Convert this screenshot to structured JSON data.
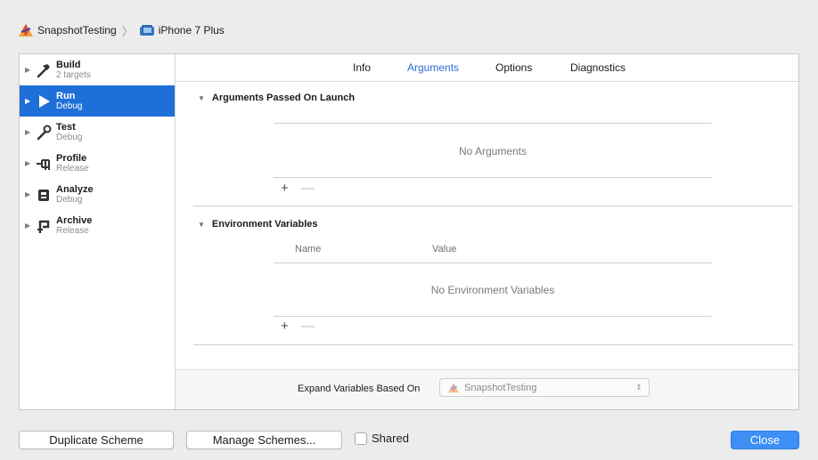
{
  "breadcrumb": {
    "project": "SnapshotTesting",
    "separator": "〉",
    "device": "iPhone 7 Plus"
  },
  "sidebar": {
    "items": [
      {
        "title": "Build",
        "subtitle": "2 targets",
        "icon": "hammer-icon",
        "selected": false
      },
      {
        "title": "Run",
        "subtitle": "Debug",
        "icon": "play-icon",
        "selected": true
      },
      {
        "title": "Test",
        "subtitle": "Debug",
        "icon": "wrench-icon",
        "selected": false
      },
      {
        "title": "Profile",
        "subtitle": "Release",
        "icon": "tuning-fork-icon",
        "selected": false
      },
      {
        "title": "Analyze",
        "subtitle": "Debug",
        "icon": "analyze-icon",
        "selected": false
      },
      {
        "title": "Archive",
        "subtitle": "Release",
        "icon": "archive-icon",
        "selected": false
      }
    ]
  },
  "tabs": [
    {
      "label": "Info",
      "active": false
    },
    {
      "label": "Arguments",
      "active": true
    },
    {
      "label": "Options",
      "active": false
    },
    {
      "label": "Diagnostics",
      "active": false
    }
  ],
  "arguments": {
    "heading": "Arguments Passed On Launch",
    "empty": "No Arguments",
    "add": "+",
    "remove": "—"
  },
  "environment": {
    "heading": "Environment Variables",
    "col_name": "Name",
    "col_value": "Value",
    "empty": "No Environment Variables",
    "add": "+",
    "remove": "—"
  },
  "expand": {
    "label": "Expand Variables Based On",
    "value": "SnapshotTesting"
  },
  "footer": {
    "duplicate": "Duplicate Scheme",
    "manage": "Manage Schemes...",
    "shared": "Shared",
    "close": "Close"
  },
  "colors": {
    "accent": "#1f6fd9",
    "tab_active": "#2a6cd6",
    "close_button": "#3d8ff5"
  }
}
